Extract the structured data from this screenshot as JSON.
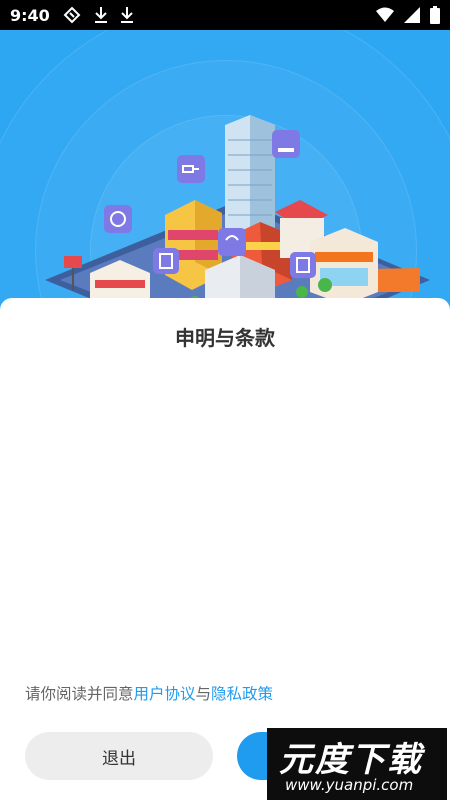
{
  "status_bar": {
    "time": "9:40"
  },
  "dialog": {
    "title": "申明与条款",
    "agreement_prefix": "请你阅读并同意",
    "user_agreement": "用户协议",
    "connector": "与",
    "privacy_policy": "隐私政策",
    "exit_label": "退出",
    "agree_label": ""
  },
  "watermark": {
    "title": "元度下载",
    "url": "www.yuanpi.com"
  },
  "colors": {
    "banner": "#2ea7f3",
    "accent": "#1f9bf0",
    "exit_button": "#ededed"
  },
  "icons": [
    "ticket-icon",
    "download-icon",
    "wifi-icon",
    "signal-icon",
    "battery-icon"
  ]
}
